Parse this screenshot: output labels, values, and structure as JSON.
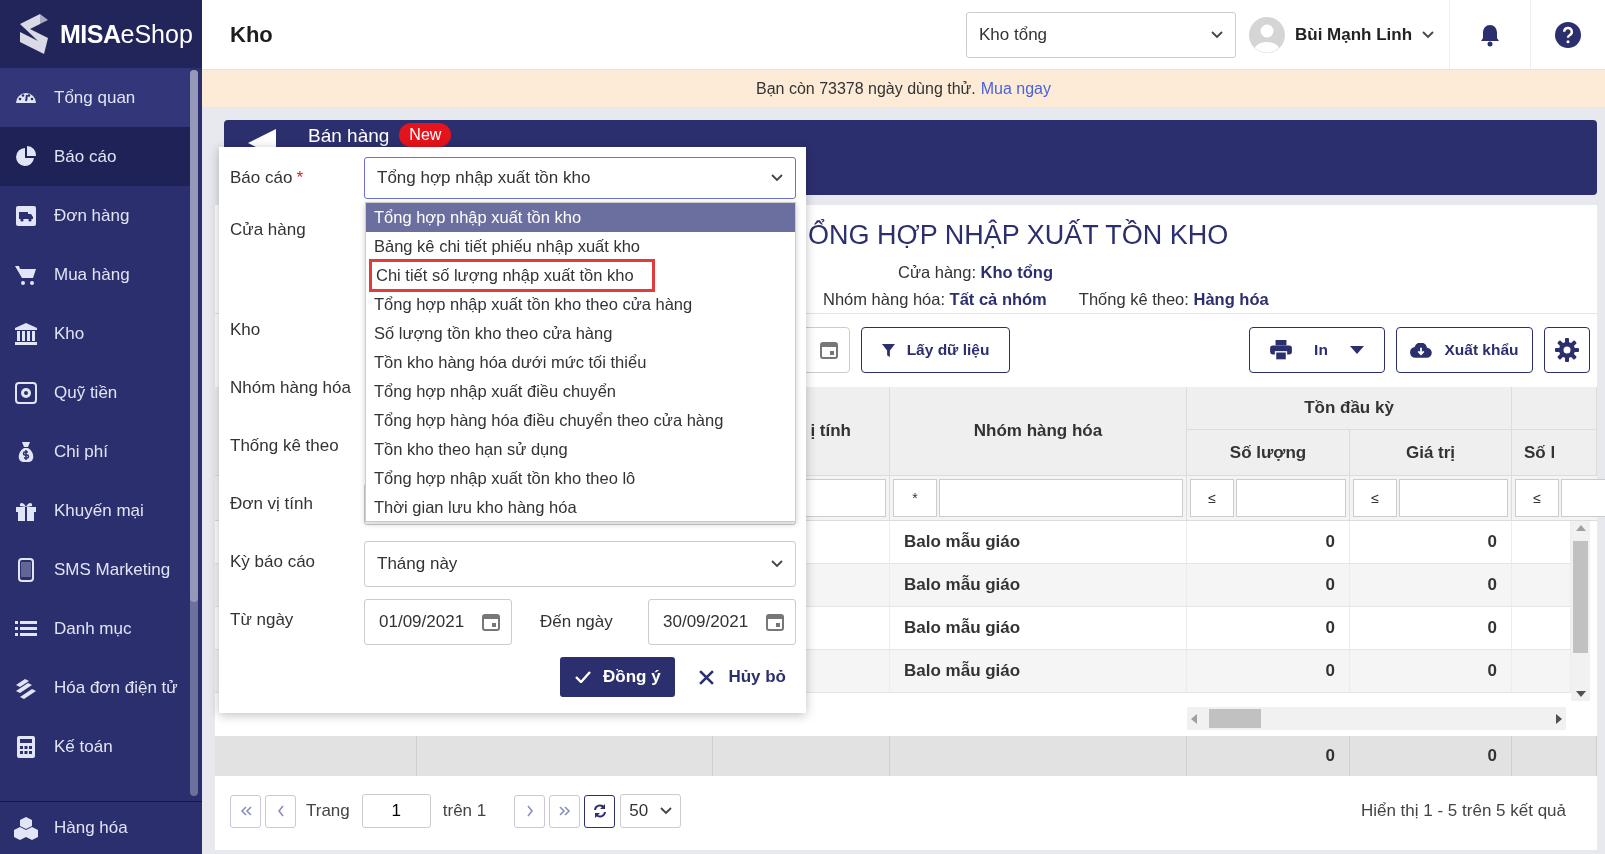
{
  "sidebar": {
    "logo": {
      "brand": "MISA",
      "product": "eShop"
    },
    "items": [
      {
        "label": "Tổng quan",
        "selected": false,
        "hovered": true
      },
      {
        "label": "Báo cáo",
        "selected": true,
        "hovered": false
      },
      {
        "label": "Đơn hàng",
        "selected": false,
        "hovered": false
      },
      {
        "label": "Mua hàng",
        "selected": false,
        "hovered": false
      },
      {
        "label": "Kho",
        "selected": false,
        "hovered": false
      },
      {
        "label": "Quỹ tiền",
        "selected": false,
        "hovered": false
      },
      {
        "label": "Chi phí",
        "selected": false,
        "hovered": false
      },
      {
        "label": "Khuyến mại",
        "selected": false,
        "hovered": false
      },
      {
        "label": "SMS Marketing",
        "selected": false,
        "hovered": false
      },
      {
        "label": "Danh mục",
        "selected": false,
        "hovered": false
      },
      {
        "label": "Hóa đơn điện tử",
        "selected": false,
        "hovered": false
      },
      {
        "label": "Kế toán",
        "selected": false,
        "hovered": false
      }
    ],
    "footer_item": {
      "label": "Hàng hóa"
    }
  },
  "header": {
    "title": "Kho",
    "store_select": {
      "value": "Kho tổng"
    },
    "user": {
      "name": "Bùi Mạnh Linh"
    }
  },
  "banner": {
    "text": "Bạn còn 73378 ngày dùng thử.",
    "link": "Mua ngay"
  },
  "tab_bar": {
    "label": "Bán hàng",
    "badge": "New"
  },
  "report": {
    "title": "ỔNG HỢP NHẬP XUẤT TỒN KHO",
    "filters": [
      {
        "label": "Cửa hàng:",
        "value": "Kho tổng"
      },
      {
        "label": "Nhóm hàng hóa:",
        "value": "Tất cả nhóm"
      },
      {
        "label": "Thống kê theo:",
        "value": "Hàng hóa"
      }
    ],
    "toolbar": {
      "fetch_button": "Lấy dữ liệu",
      "print_button": "In",
      "export_button": "Xuất khẩu"
    },
    "table": {
      "header": {
        "column_3": "ị tính",
        "group": "Nhóm hàng hóa",
        "opening": "Tồn đầu kỳ",
        "opening_qty": "Số lượng",
        "opening_value": "Giá trị",
        "column_7": "Số l"
      },
      "filter_operators": [
        "*",
        "≤",
        "≤",
        "≤"
      ],
      "rows": [
        {
          "group": "Balo mẫu giáo",
          "qty": "0",
          "value": "0"
        },
        {
          "group": "Balo mẫu giáo",
          "qty": "0",
          "value": "0"
        },
        {
          "group": "Balo mẫu giáo",
          "qty": "0",
          "value": "0"
        },
        {
          "group": "Balo mẫu giáo",
          "qty": "0",
          "value": "0"
        }
      ],
      "totals": {
        "qty": "0",
        "value": "0"
      }
    },
    "pagination": {
      "page_label": "Trang",
      "page": "1",
      "of_label": "trên 1",
      "page_size": "50",
      "summary": "Hiển thị 1 - 5 trên 5 kết quả"
    }
  },
  "filter_panel": {
    "fields": [
      {
        "kind": "select",
        "label": "Báo cáo",
        "required_mark": "*",
        "value": "Tổng hợp nhập xuất tồn kho"
      },
      {
        "kind": "covered_tall",
        "label": "Cửa hàng"
      },
      {
        "kind": "covered",
        "label": "Kho"
      },
      {
        "kind": "covered",
        "label": "Nhóm hàng hóa"
      },
      {
        "kind": "covered",
        "label": "Thống kê theo"
      },
      {
        "kind": "edge",
        "label": "Đơn vị tính"
      },
      {
        "kind": "select",
        "label": "Kỳ báo cáo",
        "value": "Tháng này"
      },
      {
        "kind": "date_range",
        "label": "Từ ngày",
        "value": "01/09/2021",
        "to_label": "Đến ngày",
        "to_value": "30/09/2021"
      }
    ],
    "dropdown": [
      {
        "label": "Tổng hợp nhập xuất tồn kho",
        "selected": true,
        "outlined": false
      },
      {
        "label": "Bảng kê chi tiết phiếu nhập xuất kho",
        "selected": false,
        "outlined": false
      },
      {
        "label": "Chi tiết số lượng nhập xuất tồn kho",
        "selected": false,
        "outlined": true
      },
      {
        "label": "Tổng hợp nhập xuất tồn kho theo cửa hàng",
        "selected": false,
        "outlined": false
      },
      {
        "label": "Số lượng tồn kho theo cửa hàng",
        "selected": false,
        "outlined": false
      },
      {
        "label": "Tồn kho hàng hóa dưới mức tối thiểu",
        "selected": false,
        "outlined": false
      },
      {
        "label": "Tổng hợp nhập xuất điều chuyển",
        "selected": false,
        "outlined": false
      },
      {
        "label": "Tổng hợp hàng hóa điều chuyển theo cửa hàng",
        "selected": false,
        "outlined": false
      },
      {
        "label": "Tồn kho theo hạn sử dụng",
        "selected": false,
        "outlined": false
      },
      {
        "label": "Tổng hợp nhập xuất tồn kho theo lô",
        "selected": false,
        "outlined": false
      },
      {
        "label": "Thời gian lưu kho hàng hóa",
        "selected": false,
        "outlined": false
      }
    ],
    "buttons": [
      {
        "kind": "primary",
        "label": "Đồng ý"
      },
      {
        "kind": "cancel",
        "label": "Hủy bỏ"
      }
    ]
  }
}
